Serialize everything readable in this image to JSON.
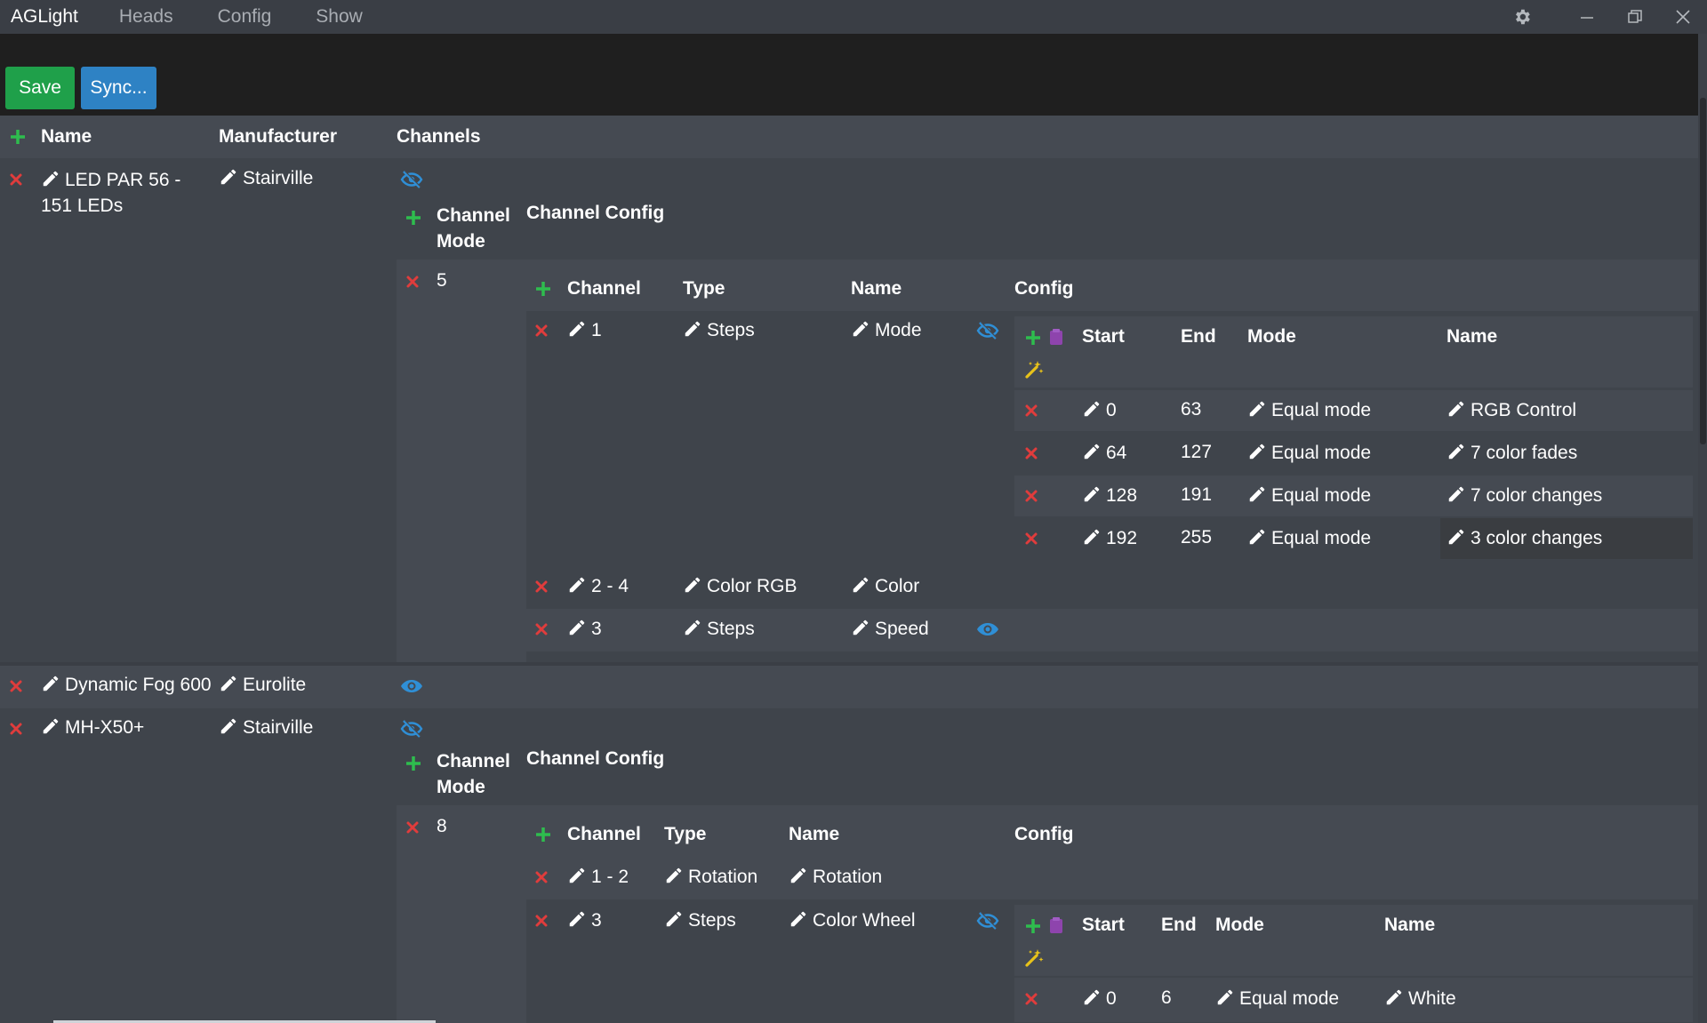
{
  "app": {
    "title": "AGLight",
    "menu": [
      "Heads",
      "Config",
      "Show"
    ]
  },
  "toolbar": {
    "save_label": "Save",
    "sync_label": "Sync..."
  },
  "colors": {
    "add": "#2ebd4e",
    "delete": "#e03c3c",
    "eye": "#2f8fd6",
    "toolbar_bg": "#1f1f1f",
    "save": "#1fa04a",
    "sync": "#2e82c4",
    "wand": "#e8c21a",
    "clipboard": "#8e44ad"
  },
  "icons": [
    "settings-gear-icon",
    "minimize-icon",
    "restore-icon",
    "close-icon",
    "plus-icon",
    "x-icon",
    "pencil-icon",
    "eye-icon",
    "eye-slash-icon",
    "clipboard-icon",
    "magic-wand-icon"
  ],
  "heads_table": {
    "columns": [
      "Name",
      "Manufacturer",
      "Channels"
    ],
    "sub_columns": [
      "Channel Mode",
      "Channel Config"
    ],
    "channel_columns": [
      "Channel",
      "Type",
      "Name",
      "Config"
    ],
    "config_columns": [
      "Start",
      "End",
      "Mode",
      "Name"
    ],
    "heads": [
      {
        "name": "LED PAR 56 - 151 LEDs",
        "manufacturer": "Stairville",
        "channels_visible": false,
        "mode": "5",
        "channels": [
          {
            "channel": "1",
            "type": "Steps",
            "name": "Mode",
            "config_visible": false,
            "config": [
              {
                "start": "0",
                "end": "63",
                "mode": "Equal mode",
                "name": "RGB Control"
              },
              {
                "start": "64",
                "end": "127",
                "mode": "Equal mode",
                "name": "7 color fades"
              },
              {
                "start": "128",
                "end": "191",
                "mode": "Equal mode",
                "name": "7 color changes"
              },
              {
                "start": "192",
                "end": "255",
                "mode": "Equal mode",
                "name": "3 color changes"
              }
            ]
          },
          {
            "channel": "2 - 4",
            "type": "Color RGB",
            "name": "Color"
          },
          {
            "channel": "3",
            "type": "Steps",
            "name": "Speed",
            "config_visible": true
          }
        ]
      },
      {
        "name": "Dynamic Fog 600",
        "manufacturer": "Eurolite",
        "channels_visible": true
      },
      {
        "name": "MH-X50+",
        "manufacturer": "Stairville",
        "channels_visible": false,
        "mode": "8",
        "channels": [
          {
            "channel": "1 - 2",
            "type": "Rotation",
            "name": "Rotation"
          },
          {
            "channel": "3",
            "type": "Steps",
            "name": "Color Wheel",
            "config_visible": false,
            "config": [
              {
                "start": "0",
                "end": "6",
                "mode": "Equal mode",
                "name": "White"
              }
            ]
          }
        ]
      }
    ]
  }
}
